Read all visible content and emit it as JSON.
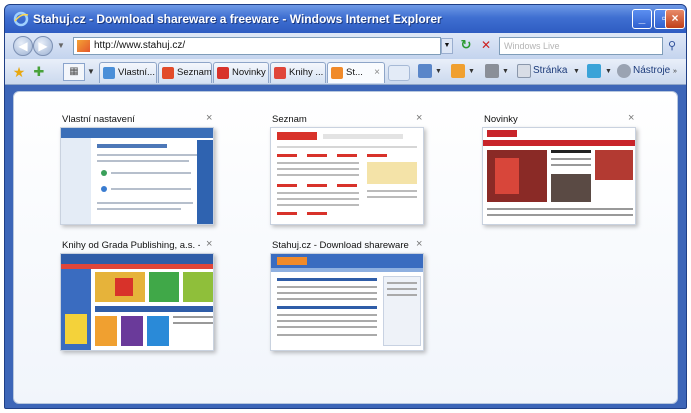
{
  "window": {
    "title": "Stahuj.cz - Download shareware a freeware - Windows Internet Explorer"
  },
  "address": {
    "url": "http://www.stahuj.cz/",
    "search_placeholder": "Windows Live"
  },
  "tabs": [
    {
      "label": "Vlastní...",
      "icon_color": "#4a8fd8"
    },
    {
      "label": "Seznam",
      "icon_color": "#e24b2a"
    },
    {
      "label": "Novinky",
      "icon_color": "#d8322a"
    },
    {
      "label": "Knihy ...",
      "icon_color": "#e0463a"
    },
    {
      "label": "St...",
      "icon_color": "#f08a2a",
      "active": true
    }
  ],
  "commands": {
    "page_label": "Stránka",
    "tools_label": "Nástroje"
  },
  "thumbnails": [
    {
      "title": "Vlastní nastavení"
    },
    {
      "title": "Seznam"
    },
    {
      "title": "Novinky"
    },
    {
      "title": "Knihy od Grada Publishing, a.s. - ..."
    },
    {
      "title": "Stahuj.cz - Download shareware ..."
    }
  ],
  "colors": {
    "titlebar": "#3f6fd1",
    "toolbar": "#dfe8f7",
    "accent_orange": "#f08a2a"
  }
}
